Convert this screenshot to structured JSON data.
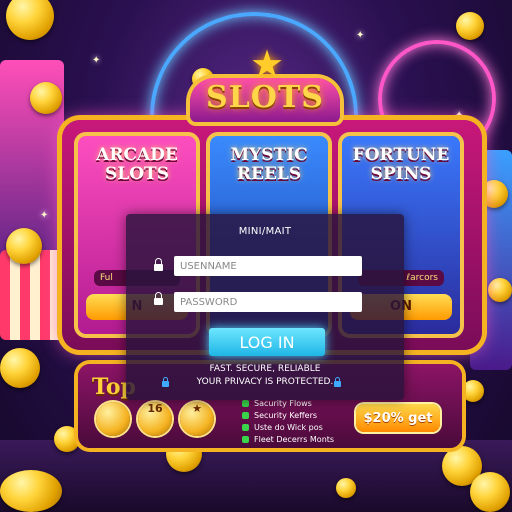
{
  "header": {
    "logo_text": "SLOTS"
  },
  "reels": [
    {
      "title_line1": "ARCADE",
      "title_line2": "SLOTS",
      "tag": "Ful",
      "button": "N"
    },
    {
      "title_line1": "MYSTIC",
      "title_line2": "REELS",
      "tag": "",
      "button": ""
    },
    {
      "title_line1": "FORTUNE",
      "title_line2": "SPINS",
      "tag": "ℓarcors",
      "button": "ON"
    }
  ],
  "login": {
    "title": "MINI/MAIT",
    "username_placeholder": "USENNAME",
    "password_placeholder": "PASSWORD",
    "button_label": "LOG IN",
    "tagline1": "FAST. SECURE, RELIABLE",
    "tagline2": "YOUR PRIVACY IS PROTECTED."
  },
  "promo": {
    "title": "Top",
    "badge_middle": "16",
    "features": [
      "Sacurity Flows",
      "Security Keffers",
      "Uste do Wick pos",
      "Fleet Decerrs Monts"
    ],
    "cta_label": "$20% get"
  },
  "colors": {
    "accent_gold": "#f5b321",
    "login_button": "#1fb6e6",
    "panel_magenta": "#8c1466"
  }
}
